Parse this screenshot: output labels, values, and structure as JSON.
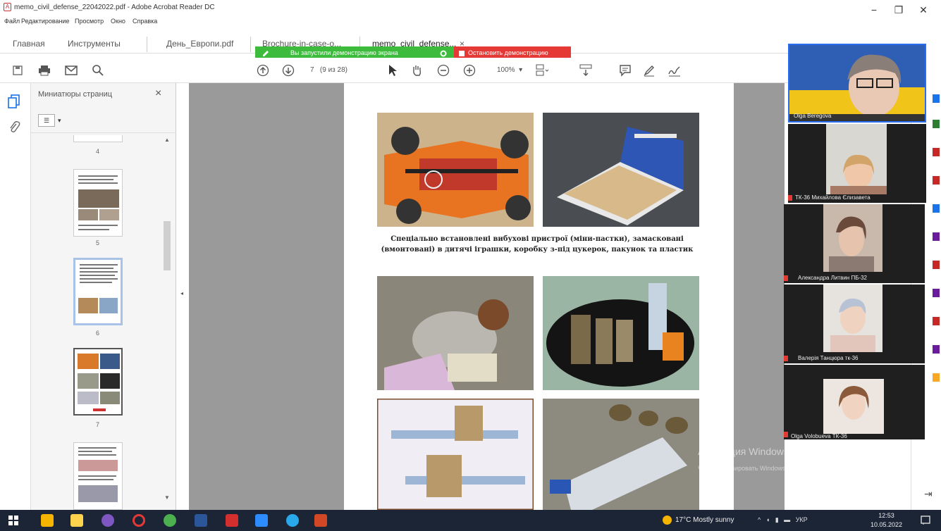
{
  "window": {
    "title": "memo_civil_defense_22042022.pdf - Adobe Acrobat Reader DC",
    "minimize_glyph": "−",
    "maximize_glyph": "❐",
    "close_glyph": "✕"
  },
  "menu": [
    "Файл",
    "Редактирование",
    "Просмотр",
    "Окно",
    "Справка"
  ],
  "tabs": {
    "home": "Главная",
    "tools": "Инструменты",
    "docs": [
      "День_Европи.pdf",
      "Brochure-in-case-o...",
      "memo_civil_defense..."
    ],
    "close_glyph": "×"
  },
  "share": {
    "banner": "Вы запустили демонстрацию экрана",
    "stop": "Остановить демонстрацию"
  },
  "toolbar": {
    "page_current": "7",
    "page_of": "(9 из 28)",
    "zoom": "100%"
  },
  "thumbnails": {
    "title": "Миниатюры страниц",
    "close_glyph": "×",
    "pages": [
      "4",
      "5",
      "6",
      "7"
    ]
  },
  "document": {
    "caption": "Спеціально встановлені вибухові пристрої (міни-пастки), замасковані (вмонтовані) в дитячі іграшки, коробку з-під цукерок, пакунок та пластик"
  },
  "watermark": {
    "line1": "Активация Windows",
    "line2": "Чтобы активировать Windows, перейдите в раздел «Параметры»."
  },
  "participants": [
    {
      "name": "Olga Beregova"
    },
    {
      "name": "ТК-36 Михайлова Єлизавета"
    },
    {
      "name": "Александра Литвин ПБ-32"
    },
    {
      "name": "Валерія Танцюра тк-36"
    },
    {
      "name": "Olga Volobueva ТК-36"
    }
  ],
  "taskbar": {
    "weather": "17°C  Mostly sunny",
    "lang": "УКР",
    "time": "12:53",
    "date": "10.05.2022"
  },
  "colors": {
    "share_green": "#3dbb3d",
    "share_red": "#e53935",
    "taskbar": "#1b2536"
  }
}
